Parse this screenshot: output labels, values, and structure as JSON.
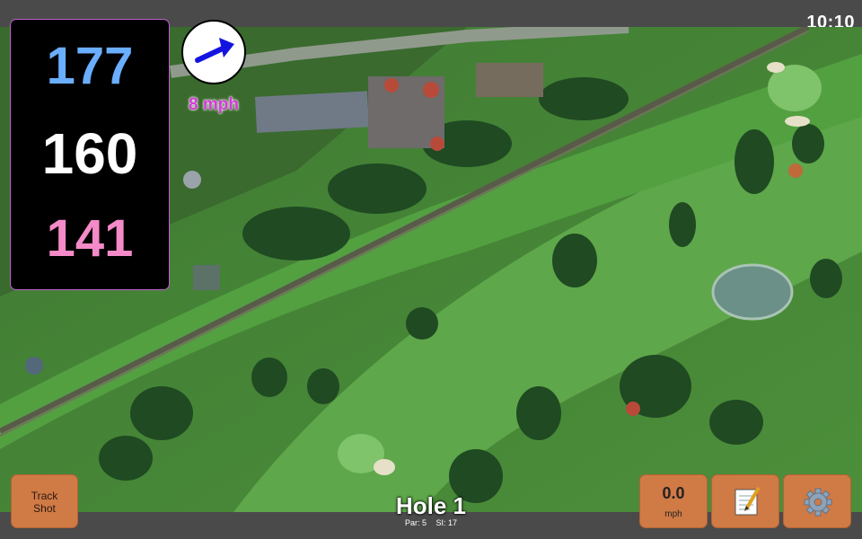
{
  "status": {
    "time": "10:10"
  },
  "yardages": {
    "back": "177",
    "middle": "160",
    "front": "141"
  },
  "wind": {
    "speed": "8 mph",
    "icon": "wind-direction-arrow-icon"
  },
  "hole": {
    "title": "Hole 1",
    "par": "Par: 5",
    "stroke_index": "SI: 17"
  },
  "buttons": {
    "track_shot_line1": "Track",
    "track_shot_line2": "Shot",
    "speed_value": "0.0",
    "speed_unit": "mph",
    "notes_icon": "notepad-icon",
    "settings_icon": "gear-icon"
  },
  "colors": {
    "back": "#6aaeff",
    "middle": "#ffffff",
    "front": "#f48ac8",
    "button": "#d07a45",
    "wind_text": "#d43ad8"
  }
}
